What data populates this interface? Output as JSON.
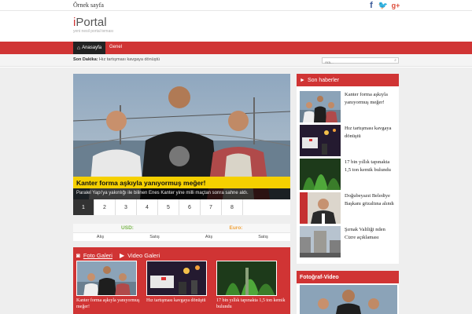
{
  "topbar": {
    "sample_page": "Örnek sayfa"
  },
  "social": {
    "facebook_icon": "f",
    "twitter_icon": "🐦",
    "googleplus_icon": "g+"
  },
  "header": {
    "logo_prefix": "i",
    "logo_rest": "Portal",
    "tagline": "yeni nesil portal teması"
  },
  "nav": {
    "home_label": "Anasayfa",
    "general_label": "Genel"
  },
  "breaking": {
    "label": "Son Dakika:",
    "text": "Hız tartışması kavgaya dönüştü"
  },
  "search": {
    "placeholder": "Ara..."
  },
  "slider": {
    "title": "Kanter forma aşkıyla yanıyormuş meğer!",
    "description": "Paralel Yapı'ya yakınlığı ile bilinen Enes Kanter yine milli maçtan sonra sahne aldı.",
    "pages": [
      "1",
      "2",
      "3",
      "4",
      "5",
      "6",
      "7",
      "8"
    ],
    "active_page": "1"
  },
  "currency": {
    "usd_label": "USD:",
    "eur_label": "Euro:",
    "buy": "Alış",
    "sell": "Satış"
  },
  "gallery": {
    "photo_tab": "Foto Galeri",
    "video_tab": "Video Galeri",
    "items": [
      {
        "caption": "Kanter forma aşkıyla yanıyormuş meğer!"
      },
      {
        "caption": "Hız tartışması kavgaya dönüştü"
      },
      {
        "caption": "17 bin yıllık tapınakta 1,5 ton kemik bulundu"
      }
    ]
  },
  "sidebar": {
    "title": "Son haberler",
    "items": [
      {
        "text": "Kanter forma aşkıyla yanıyormuş meğer!"
      },
      {
        "text": "Hız tartışması kavgaya dönüştü"
      },
      {
        "text": "17 bin yıllık tapınakta 1,5 ton kemik bulundu"
      },
      {
        "text": "Doğubeyazıt Belediye Başkanı gözaltına alındı"
      },
      {
        "text": "Şırnak Valiliği nden Cizre açıklaması"
      }
    ]
  },
  "photo_video": {
    "title": "Fotoğraf-Video"
  },
  "colors": {
    "accent": "#d03434",
    "highlight": "#f5d000",
    "dark": "#222222"
  }
}
